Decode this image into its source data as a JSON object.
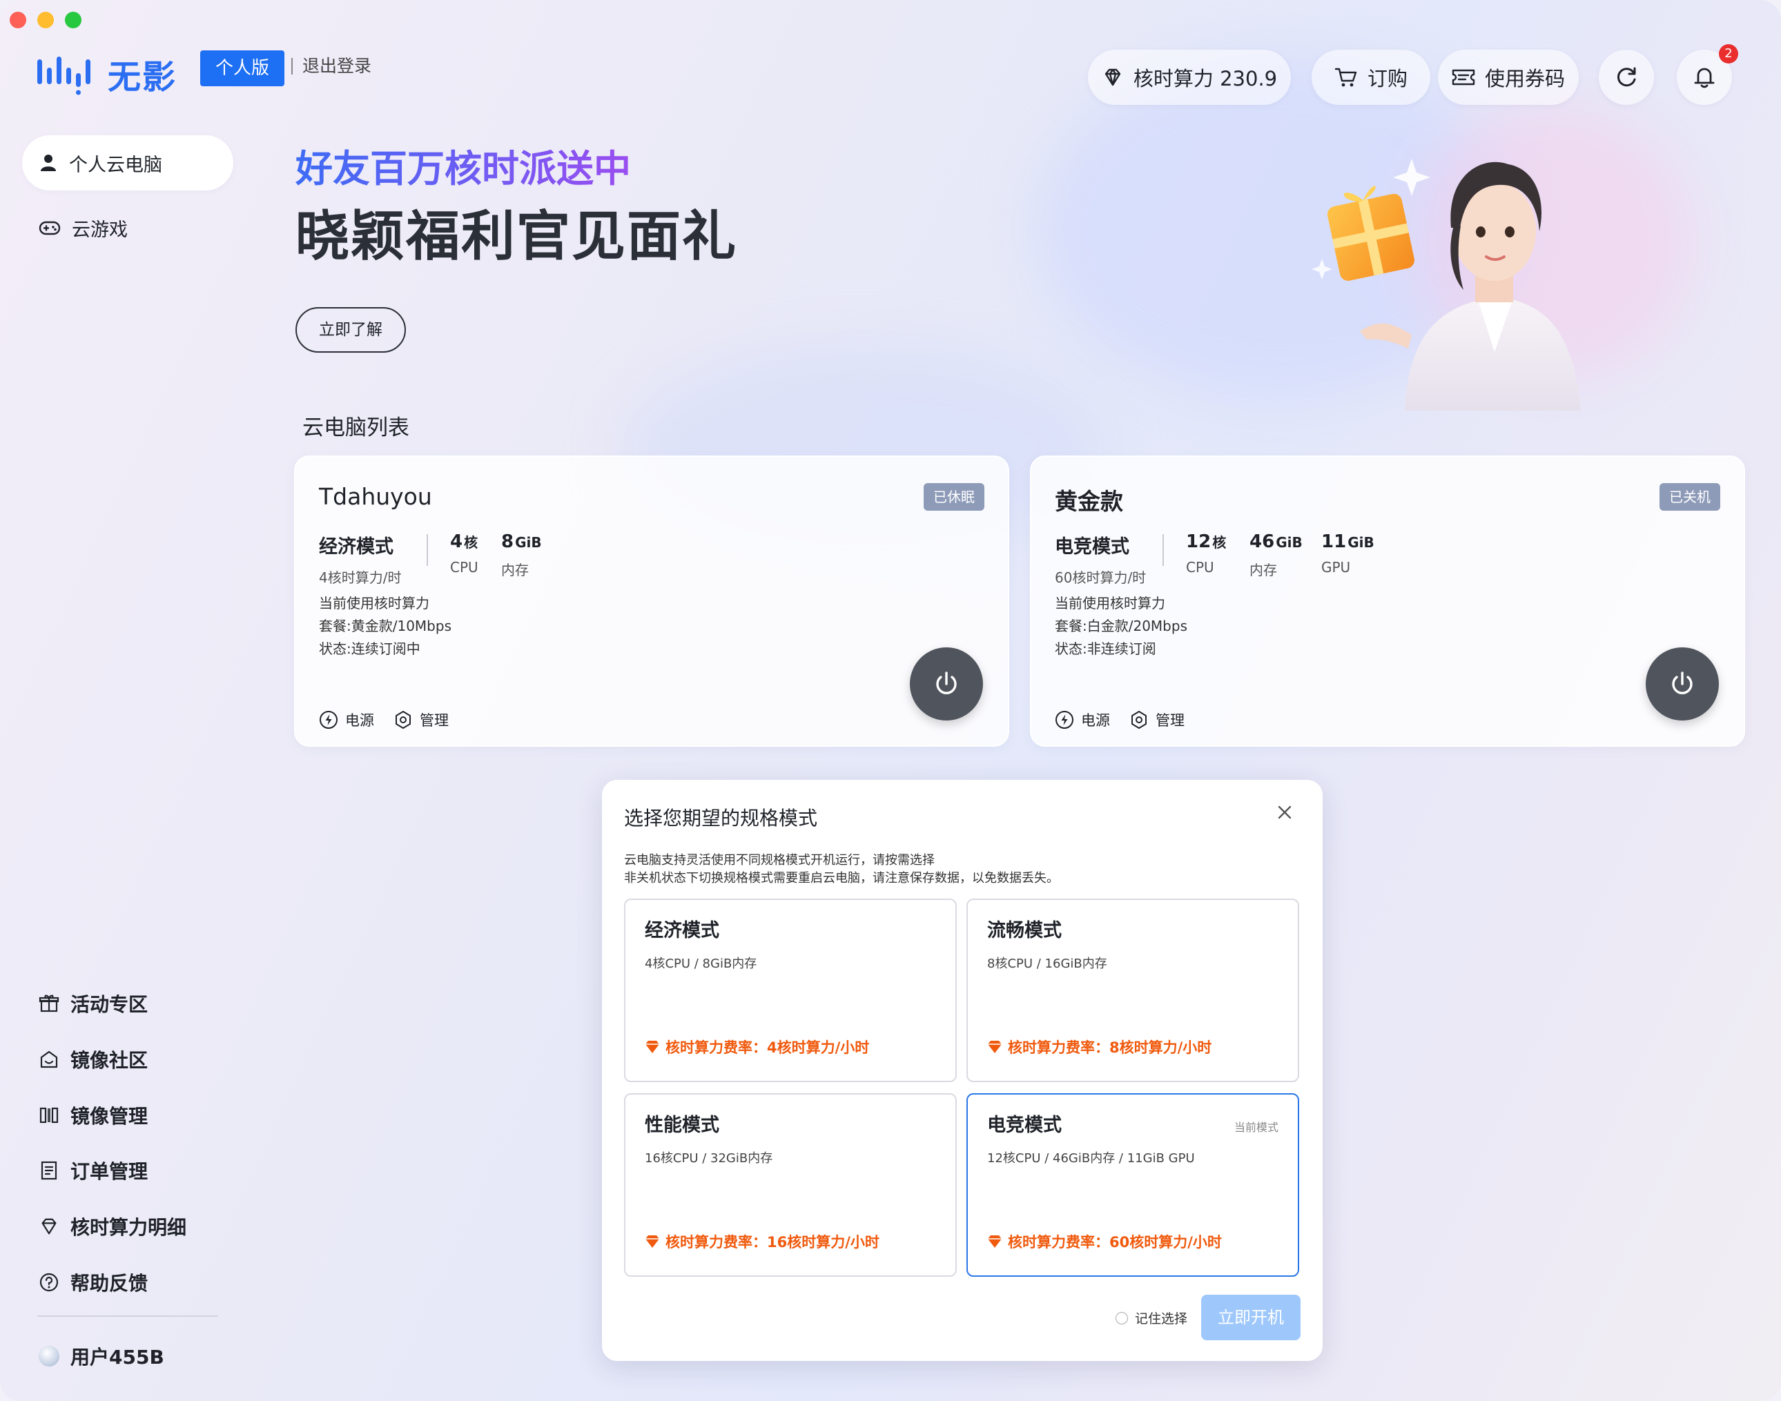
{
  "header": {
    "logo_text": "无影",
    "edition": "个人版",
    "logout": "退出登录",
    "compute": "核时算力 230.9",
    "order": "订购",
    "coupon": "使用券码",
    "notification_count": "2"
  },
  "sidebar": {
    "top": [
      {
        "label": "个人云电脑",
        "icon": "user-icon"
      },
      {
        "label": "云游戏",
        "icon": "gamepad-icon"
      }
    ],
    "bottom": [
      {
        "label": "活动专区",
        "icon": "gift-box-icon"
      },
      {
        "label": "镜像社区",
        "icon": "image-community-icon"
      },
      {
        "label": "镜像管理",
        "icon": "image-manage-icon"
      },
      {
        "label": "订单管理",
        "icon": "order-list-icon"
      },
      {
        "label": "核时算力明细",
        "icon": "diamond-icon"
      },
      {
        "label": "帮助反馈",
        "icon": "help-icon"
      }
    ],
    "user": "用户455B"
  },
  "banner": {
    "line1": "好友百万核时派送中",
    "line2": "晓颖福利官见面礼",
    "button": "立即了解"
  },
  "list_title": "云电脑列表",
  "computers": [
    {
      "name": "Tdahuyou",
      "status": "已休眠",
      "mode": "经济模式",
      "rate": "4核时算力/时",
      "specs": [
        {
          "value": "4",
          "unit": "核",
          "label": "CPU"
        },
        {
          "value": "8",
          "unit": "GiB",
          "label": "内存"
        }
      ],
      "info": [
        "当前使用核时算力",
        "套餐:黄金款/10Mbps",
        "状态:连续订阅中"
      ],
      "power": "电源",
      "manage": "管理"
    },
    {
      "name": "黄金款",
      "status": "已关机",
      "mode": "电竞模式",
      "rate": "60核时算力/时",
      "specs": [
        {
          "value": "12",
          "unit": "核",
          "label": "CPU"
        },
        {
          "value": "46",
          "unit": "GiB",
          "label": "内存"
        },
        {
          "value": "11",
          "unit": "GiB",
          "label": "GPU"
        }
      ],
      "info": [
        "当前使用核时算力",
        "套餐:白金款/20Mbps",
        "状态:非连续订阅"
      ],
      "power": "电源",
      "manage": "管理"
    }
  ],
  "modal": {
    "title": "选择您期望的规格模式",
    "desc1": "云电脑支持灵活使用不同规格模式开机运行，请按需选择",
    "desc2": "非关机状态下切换规格模式需要重启云电脑，请注意保存数据，以免数据丢失。",
    "options": [
      {
        "title": "经济模式",
        "spec": "4核CPU / 8GiB内存",
        "rate": "核时算力费率：4核时算力/小时",
        "current": ""
      },
      {
        "title": "流畅模式",
        "spec": "8核CPU / 16GiB内存",
        "rate": "核时算力费率：8核时算力/小时",
        "current": ""
      },
      {
        "title": "性能模式",
        "spec": "16核CPU / 32GiB内存",
        "rate": "核时算力费率：16核时算力/小时",
        "current": ""
      },
      {
        "title": "电竞模式",
        "spec": "12核CPU / 46GiB内存 / 11GiB GPU",
        "rate": "核时算力费率：60核时算力/小时",
        "current": "当前模式"
      }
    ],
    "remember": "记住选择",
    "confirm": "立即开机"
  },
  "colors": {
    "accent": "#1d6ff3",
    "rate": "#f05a0e",
    "status_badge": "#8e9bb8",
    "power_button": "#50545c"
  }
}
